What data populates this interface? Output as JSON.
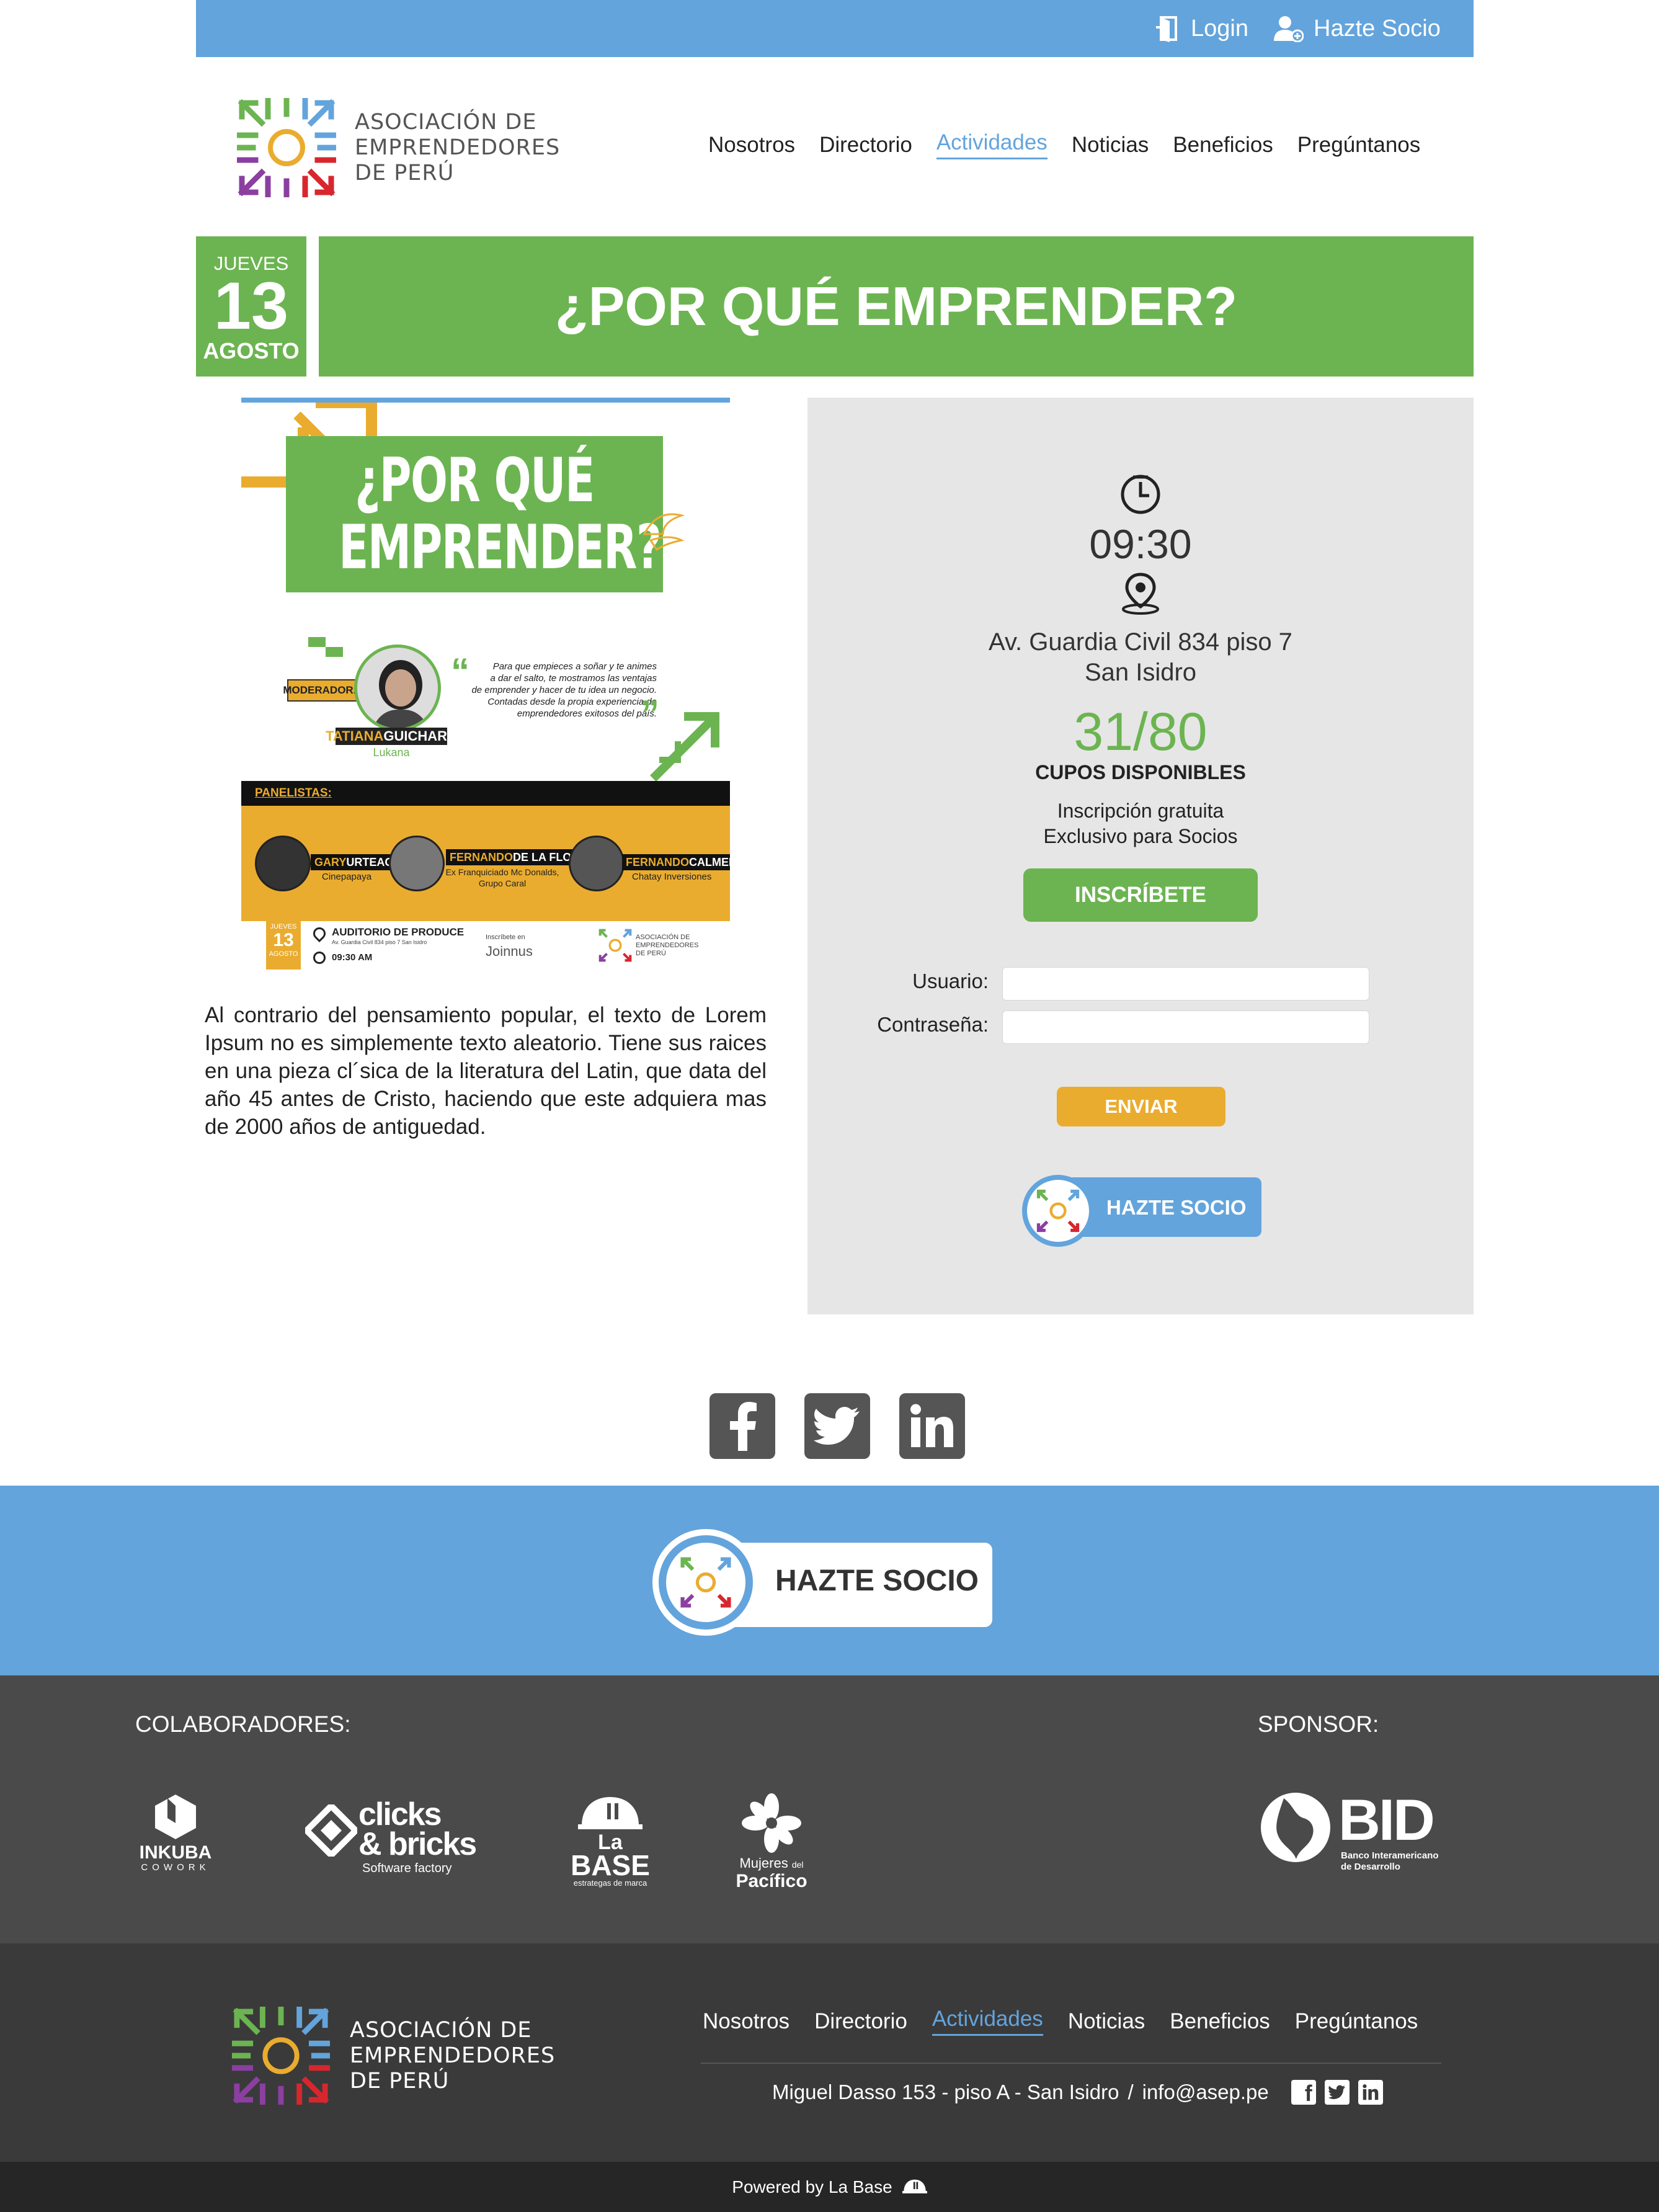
{
  "topbar": {
    "login": "Login",
    "join": "Hazte Socio"
  },
  "brand": {
    "line1": "ASOCIACIÓN DE",
    "line2": "EMPRENDEDORES",
    "line3": "DE PERÚ"
  },
  "nav": {
    "items": [
      "Nosotros",
      "Directorio",
      "Actividades",
      "Noticias",
      "Beneficios",
      "Pregúntanos"
    ],
    "active": "Actividades"
  },
  "event": {
    "weekday": "JUEVES",
    "day": "13",
    "month": "AGOSTO",
    "title": "¿POR QUÉ EMPRENDER?",
    "description": "Al contrario del pensamiento popular, el texto de Lorem Ipsum no es simplemente texto aleatorio. Tiene sus raices en una pieza cl´sica de la literatura del Latin, que data del año 45 antes de Cristo, haciendo que este adquiera mas de 2000 años de antiguedad."
  },
  "poster": {
    "title1": "¿POR QUÉ",
    "title2": "EMPRENDER?",
    "moderator_label": "MODERADORA:",
    "moderator_first": "TATIANA",
    "moderator_last": "GUICHARD",
    "moderator_org": "Lukana",
    "quote_line1": "Para que empieces a soñar y te animes",
    "quote_line2": "a dar el salto, te mostramos las ventajas",
    "quote_line3": "de emprender y hacer de tu idea un negocio.",
    "quote_line4": "Contadas desde la propia experiencia de",
    "quote_line5": "emprendedores exitosos del país.",
    "panel_label": "PANELISTAS:",
    "p1_first": "GARY",
    "p1_last": "URTEAGA",
    "p1_org": "Cinepapaya",
    "p2_first": "FERNANDO",
    "p2_last": "DE LA FLOR",
    "p2_org1": "Ex Franquiciado Mc Donalds,",
    "p2_org2": "Grupo Caral",
    "p3_first": "FERNANDO",
    "p3_last": "CALMELL",
    "p3_org": "Chatay Inversiones",
    "date_weekday": "JUEVES",
    "date_day": "13",
    "date_month": "AGOSTO",
    "venue": "AUDITORIO DE PRODUCE",
    "venue_address": "Av. Guardia Civil 834 piso 7 San Isidro",
    "time": "09:30 AM",
    "signup_label": "Inscríbete en",
    "signup_brand": "Joinnus",
    "logo_line1": "ASOCIACIÓN DE",
    "logo_line2": "EMPRENDEDORES",
    "logo_line3": "DE PERÚ"
  },
  "panel": {
    "time": "09:30",
    "address1": "Av. Guardia Civil 834 piso 7",
    "address2": "San Isidro",
    "capacity": "31/80",
    "capacity_label": "CUPOS DISPONIBLES",
    "note1": "Inscripción gratuita",
    "note2": "Exclusivo para Socios",
    "register_button": "INSCRÍBETE",
    "user_label": "Usuario:",
    "password_label": "Contraseña:",
    "user_value": "",
    "password_value": "",
    "submit_button": "ENVIAR",
    "join_button": "HAZTE SOCIO"
  },
  "social": [
    "facebook-icon",
    "twitter-icon",
    "linkedin-icon"
  ],
  "banner": {
    "join_button": "HAZTE SOCIO"
  },
  "collaborators": {
    "title": "COLABORADORES:",
    "sponsor_title": "SPONSOR:",
    "inkuba": {
      "name": "INKUBA",
      "sub": "COWORK"
    },
    "clicks": {
      "line1": "clicks",
      "line2": "& bricks",
      "sub": "Software factory"
    },
    "labase": {
      "line1": "La",
      "line2": "BASE",
      "sub": "estrategas de marca"
    },
    "mujeres": {
      "line1": "Mujeres",
      "line1b": "del",
      "line2": "Pacífico"
    },
    "bid": {
      "name": "BID",
      "line1": "Banco Interamericano",
      "line2": "de Desarrollo"
    }
  },
  "footer": {
    "address": "Miguel Dasso 153 - piso A - San Isidro",
    "separator": "/",
    "email": "info@asep.pe",
    "powered": "Powered by La Base"
  },
  "colors": {
    "blue": "#63a4dc",
    "green": "#6cb451",
    "yellow": "#eaac2f",
    "orange": "#e7a32a",
    "red": "#d8262e",
    "purple": "#8b3fa0"
  }
}
